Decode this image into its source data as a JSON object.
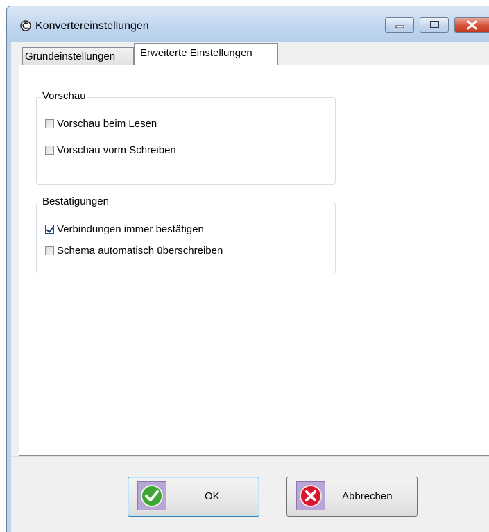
{
  "window": {
    "title": "Konvertereinstellungen",
    "icon": "converter-app-icon",
    "controls": [
      "minimize-icon",
      "maximize-icon",
      "close-icon"
    ]
  },
  "tabs": [
    {
      "label": "Grundeinstellungen",
      "active": false
    },
    {
      "label": "Erweiterte Einstellungen",
      "active": true
    }
  ],
  "groups": {
    "preview": {
      "title": "Vorschau",
      "items": [
        {
          "label": "Vorschau beim Lesen",
          "checked": false
        },
        {
          "label": "Vorschau vorm Schreiben",
          "checked": false
        }
      ]
    },
    "confirm": {
      "title": "Bestätigungen",
      "items": [
        {
          "label": "Verbindungen immer bestätigen",
          "checked": true
        },
        {
          "label": "Schema automatisch überschreiben",
          "checked": false
        }
      ]
    }
  },
  "buttons": {
    "ok": {
      "label": "OK",
      "icon": "green-check-icon"
    },
    "cancel": {
      "label": "Abbrechen",
      "icon": "red-x-icon"
    }
  }
}
